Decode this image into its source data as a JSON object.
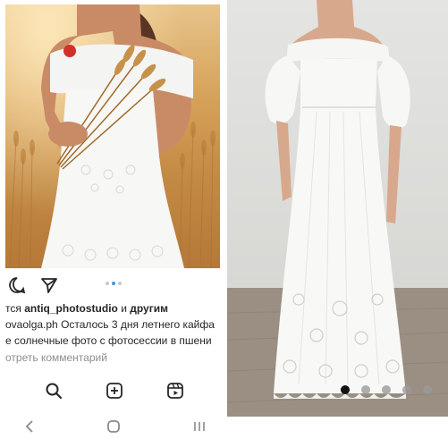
{
  "instagram": {
    "likes_prefix": "тся",
    "likes_user": "antiq_photostudio",
    "likes_and": "и",
    "likes_others": "другим",
    "caption_user": "ovaolga.ph",
    "caption_text": "Осталось 3 дня летнего кайфа",
    "caption_line2": "е солнечные фото с фотосессии в пшени",
    "view_comments": "отреть комментарий",
    "carousel": {
      "count": 3,
      "active_index": 1
    },
    "icons": {
      "comment": "comment-icon",
      "share": "send-icon",
      "search": "search-icon",
      "create": "add-post-icon",
      "reels": "reels-icon"
    },
    "colors": {
      "text": "#262626",
      "muted": "#8e8e8e",
      "accent": "#3897f0"
    }
  },
  "system_nav": {
    "back": "back-icon",
    "home": "home-icon",
    "recents": "recents-icon"
  },
  "product_carousel": {
    "count": 5,
    "active_index": 0
  }
}
